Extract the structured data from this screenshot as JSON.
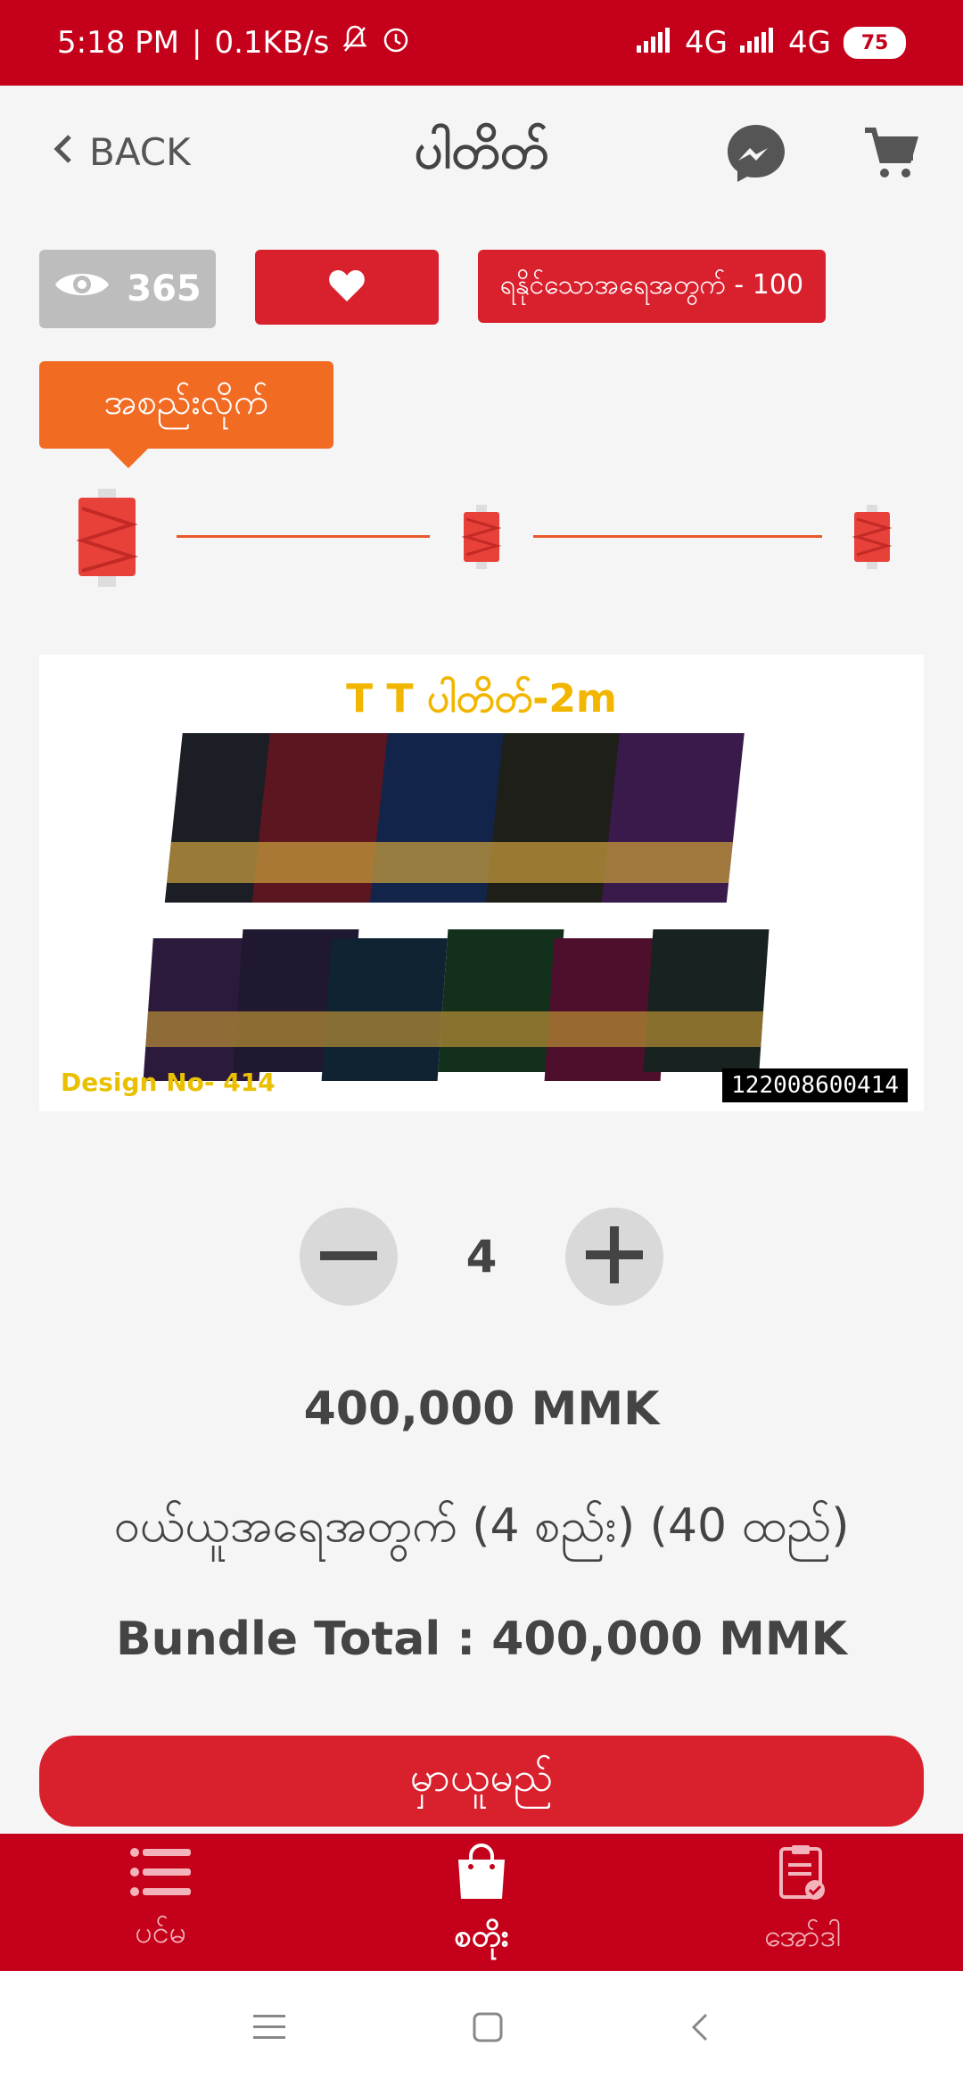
{
  "status": {
    "time": "5:18 PM",
    "speed": "0.1KB/s",
    "net1": "4G",
    "net2": "4G",
    "battery": "75"
  },
  "header": {
    "back_label": "BACK",
    "title": "ပါတိတ်",
    "icons": [
      "chevron-left-icon",
      "messenger-icon",
      "cart-icon"
    ]
  },
  "actions": {
    "views_count": "365",
    "stock_label": "ရနိုင်သောအရေအတွက် - 100"
  },
  "unit_selector": {
    "active_label": "အစည်းလိုက်",
    "options_count": 3,
    "selected_index": 0
  },
  "product_image": {
    "caption_title": "T T ပါတိတ်-2m",
    "design_no": "Design No- 414",
    "code": "122008600414"
  },
  "quantity": {
    "value": "4"
  },
  "pricing": {
    "price": "400,000 MMK",
    "bundle_qty": "ဝယ်ယူအရေအတွက် (4 စည်း) (40 ထည်)",
    "bundle_total": "Bundle Total : 400,000 MMK"
  },
  "buy_button": "မှာယူမည်",
  "bottom_nav": [
    {
      "label": "ပင်မ",
      "icon": "list-icon"
    },
    {
      "label": "စတိုး",
      "icon": "shopping-bag-icon"
    },
    {
      "label": "အော်ဒါ",
      "icon": "clipboard-check-icon"
    }
  ],
  "colors": {
    "brand_red": "#c4001a",
    "button_red": "#d9212e",
    "accent_orange": "#f26b23",
    "muted_gray": "#bdbdbd"
  }
}
